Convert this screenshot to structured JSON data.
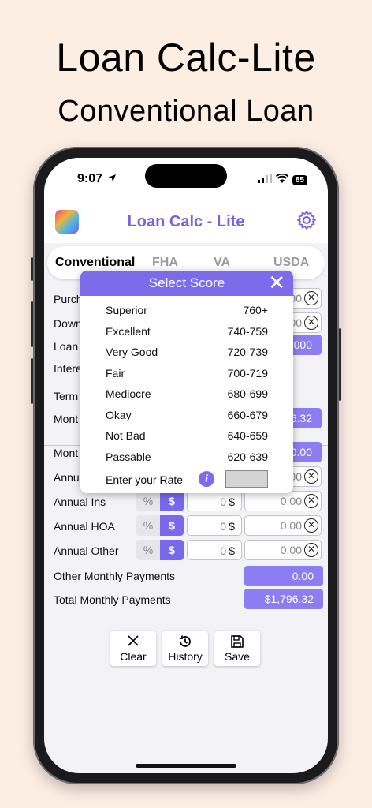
{
  "promo": {
    "title": "Loan Calc-Lite",
    "subtitle": "Conventional Loan"
  },
  "status_bar": {
    "time": "9:07",
    "battery": "85"
  },
  "header": {
    "title": "Loan Calc - Lite"
  },
  "tabs": [
    {
      "label": "Conventional",
      "active": true
    },
    {
      "label": "FHA",
      "active": false
    },
    {
      "label": "VA",
      "active": false
    },
    {
      "label": "USDA",
      "active": false
    }
  ],
  "form_rows": {
    "purchase": {
      "label": "Purch",
      "value": "00"
    },
    "down": {
      "label": "Down",
      "value": "00"
    },
    "loan": {
      "label": "Loan",
      "value": "000"
    },
    "interest": {
      "label": "Intere"
    },
    "term": {
      "label": "Term"
    },
    "monthly_pi": {
      "label": "Mont",
      "value": "6.32"
    },
    "monthly_tax": {
      "label": "Mont",
      "value": "0.00"
    },
    "annual_tax": {
      "label": "Annu",
      "value": "00"
    },
    "annual_ins": {
      "label": "Annual Ins",
      "pct": "%",
      "dollar": "$",
      "amount": "0",
      "amount_unit": "$",
      "value": "0.00"
    },
    "annual_hoa": {
      "label": "Annual HOA",
      "pct": "%",
      "dollar": "$",
      "amount": "0",
      "amount_unit": "$",
      "value": "0.00"
    },
    "annual_other": {
      "label": "Annual Other",
      "pct": "%",
      "dollar": "$",
      "amount": "0",
      "amount_unit": "$",
      "value": "0.00"
    },
    "other_monthly": {
      "label": "Other Monthly Payments",
      "value": "0.00"
    },
    "total_monthly": {
      "label": "Total Monthly Payments",
      "value": "$1,796.32"
    }
  },
  "buttons": {
    "clear": {
      "label": "Clear",
      "icon": "close-icon"
    },
    "history": {
      "label": "History",
      "icon": "history-icon"
    },
    "save": {
      "label": "Save",
      "icon": "floppy-icon"
    }
  },
  "popup": {
    "title": "Select Score",
    "scores": [
      {
        "name": "Superior",
        "range": "760+"
      },
      {
        "name": "Excellent",
        "range": "740-759"
      },
      {
        "name": "Very Good",
        "range": "720-739"
      },
      {
        "name": "Fair",
        "range": "700-719"
      },
      {
        "name": "Mediocre",
        "range": "680-699"
      },
      {
        "name": "Okay",
        "range": "660-679"
      },
      {
        "name": "Not Bad",
        "range": "640-659"
      },
      {
        "name": "Passable",
        "range": "620-639"
      }
    ],
    "rate_label": "Enter your Rate",
    "info_glyph": "i"
  },
  "colors": {
    "accent": "#7c6cec",
    "background": "#fdeee4"
  }
}
